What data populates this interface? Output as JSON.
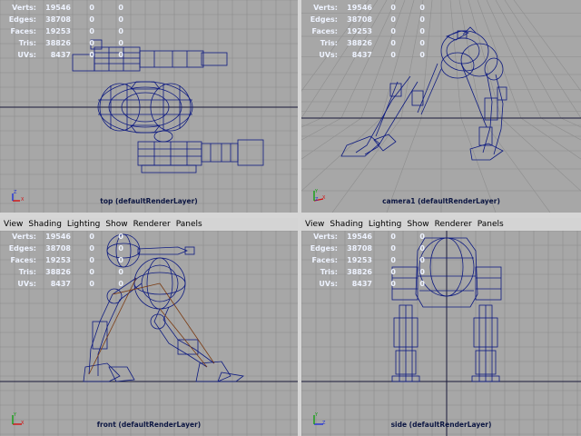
{
  "hud": {
    "labels": [
      "Verts:",
      "Edges:",
      "Faces:",
      "Tris:",
      "UVs:"
    ],
    "col1": [
      "19546",
      "38708",
      "19253",
      "38826",
      "8437"
    ],
    "col2": [
      "0",
      "0",
      "0",
      "0",
      "0"
    ],
    "col3": [
      "0",
      "0",
      "0",
      "0",
      "0"
    ]
  },
  "menu": {
    "view": "View",
    "shading": "Shading",
    "lighting": "Lighting",
    "show": "Show",
    "renderer": "Renderer",
    "panels": "Panels"
  },
  "panes": {
    "top": "top (defaultRenderLayer)",
    "persp": "camera1 (defaultRenderLayer)",
    "front": "front (defaultRenderLayer)",
    "side": "side (defaultRenderLayer)"
  },
  "axis_labels": {
    "x": "X",
    "y": "Y",
    "z": "Z"
  },
  "colors": {
    "viewport_bg": "#a7a7a7",
    "grid": "#8d8d8d",
    "wire": "#0d1a80",
    "hud_text": "#eef3ff",
    "caption": "#0c1642",
    "axis_x": "#d21010",
    "axis_y": "#10a010",
    "axis_z": "#2030d8"
  }
}
